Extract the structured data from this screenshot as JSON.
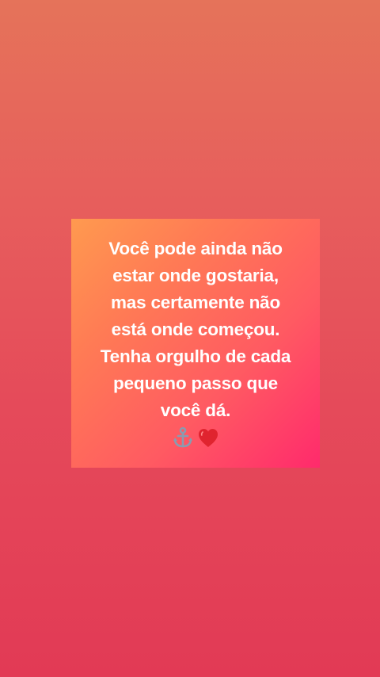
{
  "post": {
    "lines": [
      "Você pode ainda não",
      "estar onde gostaria,",
      "mas certamente não",
      "está onde começou.",
      "Tenha orgulho de cada",
      "pequeno passo que",
      "você dá."
    ],
    "emojis": [
      "anchor-icon",
      "red-heart-icon"
    ]
  },
  "colors": {
    "background_top": "#e5735a",
    "background_bottom": "#e23a55",
    "card_start": "#ff9a4f",
    "card_end": "#ff2a6c",
    "text": "#ffffff",
    "heart": "#e0242f",
    "anchor": "#8a9bb0"
  }
}
